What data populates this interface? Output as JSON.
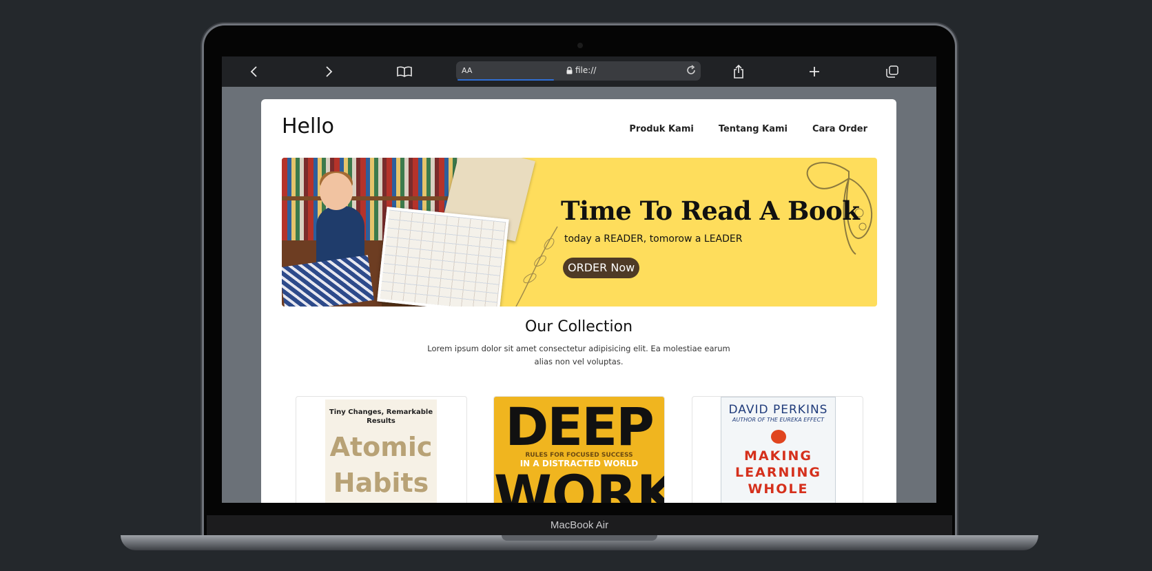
{
  "device": {
    "label": "MacBook Air"
  },
  "browser": {
    "text_size_label": "AA",
    "url": "file://",
    "icons": [
      "back-icon",
      "forward-icon",
      "bookmarks-icon",
      "lock-icon",
      "reload-icon",
      "share-icon",
      "new-tab-icon",
      "tabs-icon"
    ]
  },
  "site": {
    "brand": "Hello",
    "nav": [
      "Produk Kami",
      "Tentang Kami",
      "Cara Order"
    ],
    "banner": {
      "headline": "Time To Read A Book",
      "subline": "today a READER, tomorow a LEADER",
      "cta": "ORDER Now",
      "color": "#fedd5c"
    },
    "collection": {
      "title": "Our Collection",
      "text": "Lorem ipsum dolor sit amet consectetur adipisicing elit. Ea molestiae earum alias non vel voluptas."
    },
    "books": [
      {
        "tagline": "Tiny Changes, Remarkable Results",
        "title_line1": "Atomic",
        "title_line2": "Habits"
      },
      {
        "title_line1": "DEEP",
        "tagline_line1": "RULES FOR FOCUSED SUCCESS",
        "tagline_line2": "IN A DISTRACTED WORLD",
        "title_line2": "WORK"
      },
      {
        "author": "DAVID PERKINS",
        "author_note": "AUTHOR OF THE EUREKA EFFECT",
        "title_line1": "MAKING",
        "title_line2": "LEARNING",
        "title_line3": "WHOLE"
      }
    ]
  }
}
